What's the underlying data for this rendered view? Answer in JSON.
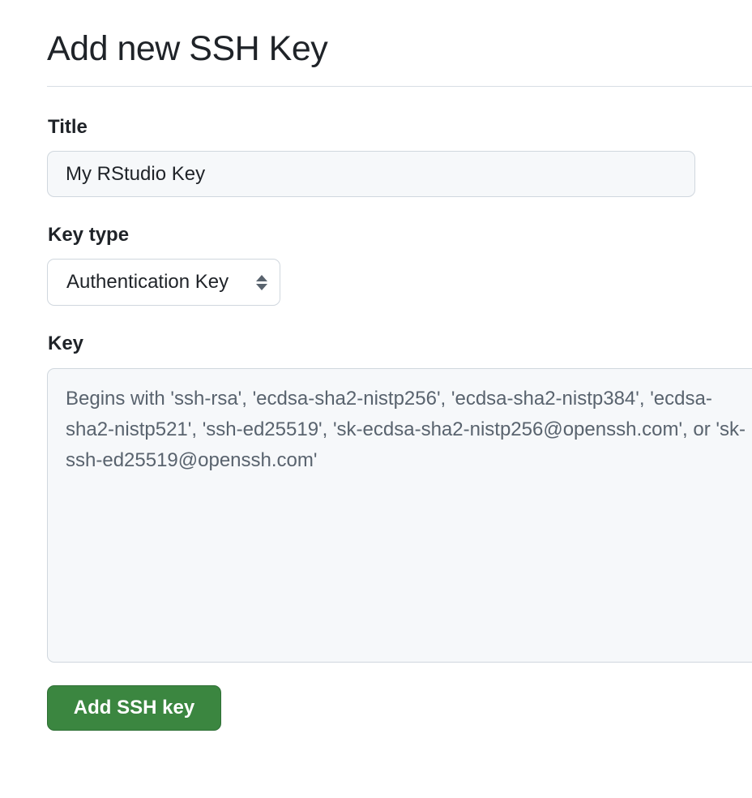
{
  "page": {
    "title": "Add new SSH Key"
  },
  "form": {
    "title_label": "Title",
    "title_value": "My RStudio Key",
    "key_type_label": "Key type",
    "key_type_selected": "Authentication Key",
    "key_label": "Key",
    "key_placeholder": "Begins with 'ssh-rsa', 'ecdsa-sha2-nistp256', 'ecdsa-sha2-nistp384', 'ecdsa-sha2-nistp521', 'ssh-ed25519', 'sk-ecdsa-sha2-nistp256@openssh.com', or 'sk-ssh-ed25519@openssh.com'",
    "submit_label": "Add SSH key"
  },
  "icons": {
    "select_arrows": "select-updown-icon"
  },
  "colors": {
    "primary_button": "#3b8640",
    "input_background": "#f6f8fa",
    "border": "#d0d7de"
  }
}
